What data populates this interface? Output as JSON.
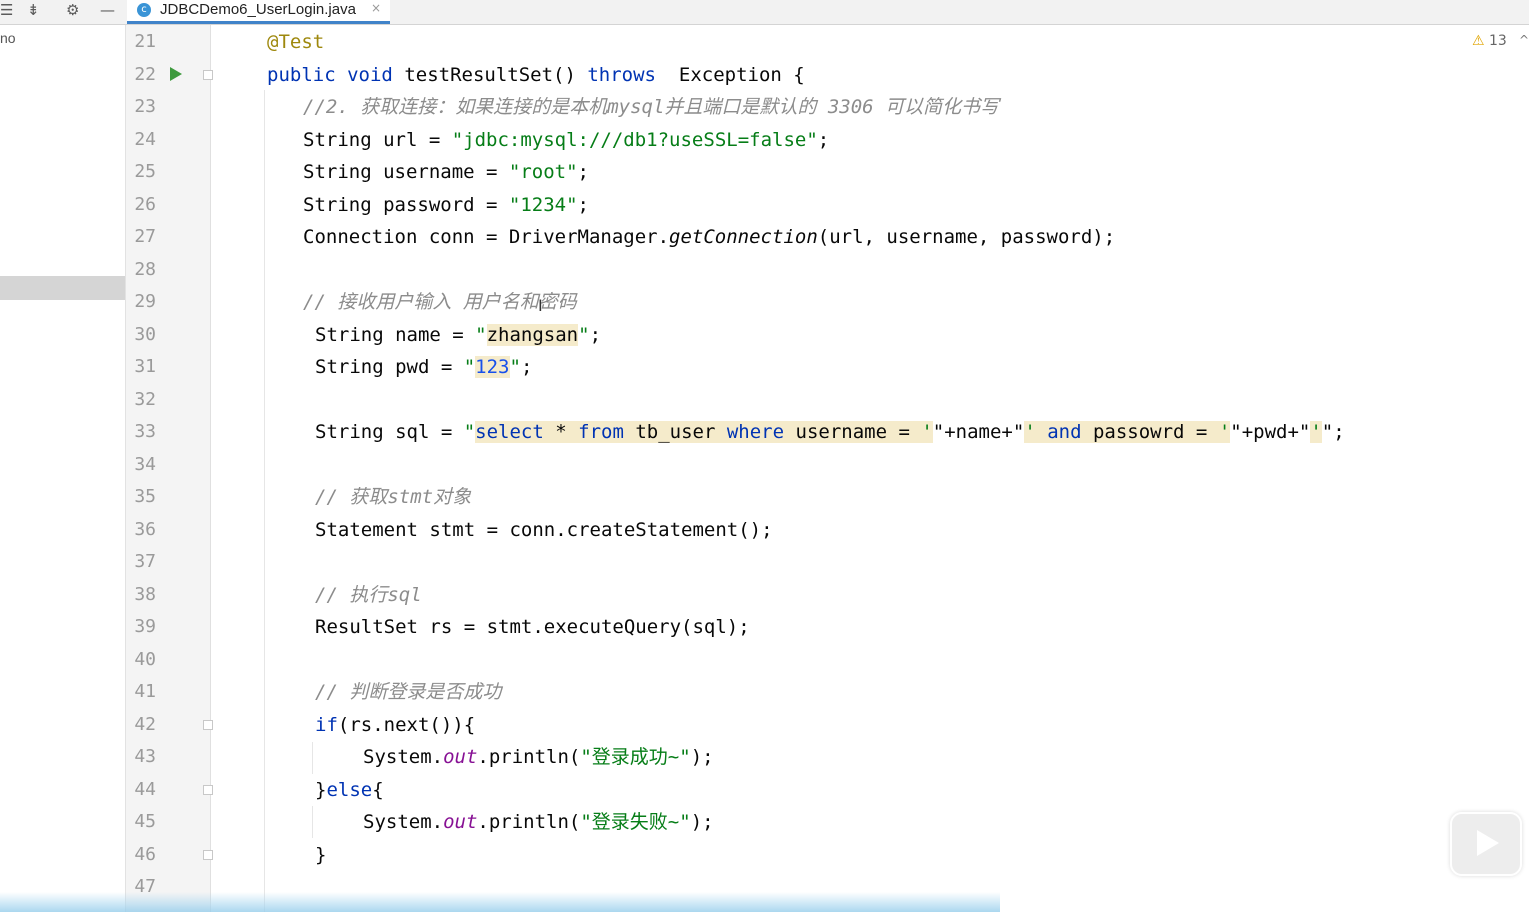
{
  "toolbar": {
    "icons": [
      "list-icon",
      "collapse-all-icon",
      "gear-icon",
      "minimize-icon"
    ]
  },
  "tab": {
    "filename": "JDBCDemo6_UserLogin.java",
    "close": "×",
    "icon_letter": "c"
  },
  "left_panel": {
    "text": "no"
  },
  "inspection": {
    "warning_count": "13",
    "warning_glyph": "⚠",
    "expand_glyph": "^"
  },
  "line_numbers": [
    "21",
    "22",
    "23",
    "24",
    "25",
    "26",
    "27",
    "28",
    "29",
    "30",
    "31",
    "32",
    "33",
    "34",
    "35",
    "36",
    "37",
    "38",
    "39",
    "40",
    "41",
    "42",
    "43",
    "44",
    "45",
    "46",
    "47"
  ],
  "code": {
    "l21": {
      "annotation": "@Test"
    },
    "l22": {
      "kw1": "public",
      "kw2": "void",
      "name": "testResultSet()",
      "kw3": "throws",
      "rest": "  Exception {"
    },
    "l23": {
      "comment": "//2. 获取连接：如果连接的是本机mysql并且端口是默认的 3306 可以简化书写"
    },
    "l24": {
      "a": "String url = ",
      "s": "\"jdbc:mysql:///db1?useSSL=false\"",
      "b": ";"
    },
    "l25": {
      "a": "String username = ",
      "s": "\"root\"",
      "b": ";"
    },
    "l26": {
      "a": "String password = ",
      "s": "\"1234\"",
      "b": ";"
    },
    "l27": {
      "a": "Connection conn = DriverManager.",
      "m": "getConnection",
      "b": "(url, username, password);"
    },
    "l29": {
      "comment": "// 接收用户输入 用户名和密码"
    },
    "l30": {
      "a": "String name = ",
      "q1": "\"",
      "s": "zhangsan",
      "q2": "\"",
      "b": ";"
    },
    "l31": {
      "a": "String pwd = ",
      "q1": "\"",
      "s": "123",
      "q2": "\"",
      "b": ";"
    },
    "l33": {
      "a": "String sql = ",
      "q": "\"",
      "k1": "select",
      "p1": " * ",
      "k2": "from",
      "p2": " tb_user ",
      "k3": "where",
      "p3": " username = ",
      "s1": "'",
      "c1": "\"+name+\"",
      "s2": "' ",
      "k4": "and",
      "p4": " passowrd = ",
      "s3": "'",
      "c2": "\"+pwd+\"",
      "s4": "'",
      "end": "\";"
    },
    "l35": {
      "comment": "// 获取stmt对象"
    },
    "l36": {
      "text": "Statement stmt = conn.createStatement();"
    },
    "l38": {
      "comment": "// 执行sql"
    },
    "l39": {
      "text": "ResultSet rs = stmt.executeQuery(sql);"
    },
    "l41": {
      "comment": "// 判断登录是否成功"
    },
    "l42": {
      "kw": "if",
      "rest": "(rs.next()){"
    },
    "l43": {
      "a": "System.",
      "f": "out",
      "b": ".println(",
      "s": "\"登录成功~\"",
      "c": ");"
    },
    "l44": {
      "a": "}",
      "kw": "else",
      "b": "{"
    },
    "l45": {
      "a": "System.",
      "f": "out",
      "b": ".println(",
      "s": "\"登录失败~\"",
      "c": ");"
    },
    "l46": {
      "text": "}"
    }
  }
}
